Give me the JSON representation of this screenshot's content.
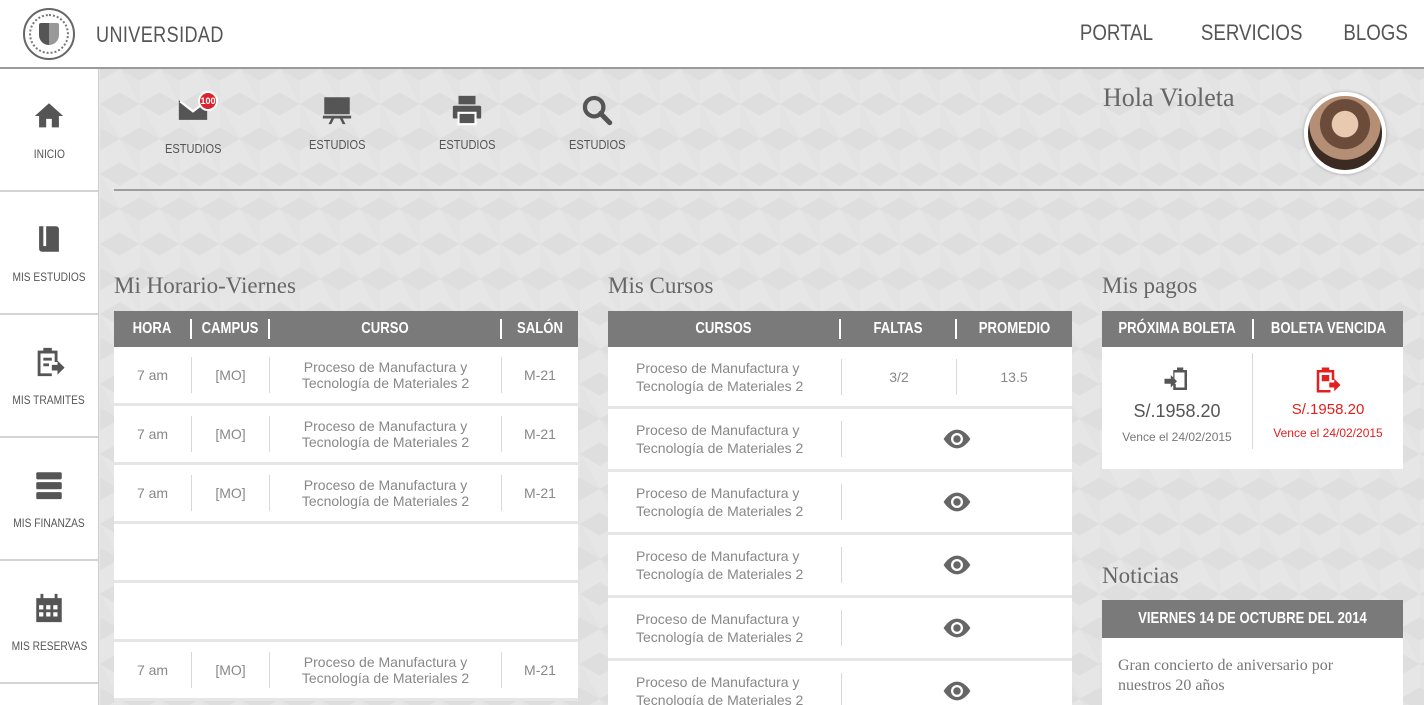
{
  "header": {
    "brand": "UNIVERSIDAD",
    "nav": [
      "PORTAL",
      "SERVICIOS",
      "BLOGS"
    ]
  },
  "sidebar": {
    "items": [
      {
        "label": "INICIO",
        "icon": "home-icon"
      },
      {
        "label": "MIS ESTUDIOS",
        "icon": "book-icon"
      },
      {
        "label": "MIS TRAMITES",
        "icon": "clipboard-arrow-icon"
      },
      {
        "label": "MIS FINANZAS",
        "icon": "server-icon"
      },
      {
        "label": "MIS RESERVAS",
        "icon": "calendar-icon"
      }
    ]
  },
  "quick_actions": [
    {
      "label": "ESTUDIOS",
      "icon": "mail-icon",
      "badge": "100"
    },
    {
      "label": "ESTUDIOS",
      "icon": "desktop-icon"
    },
    {
      "label": "ESTUDIOS",
      "icon": "printer-icon"
    },
    {
      "label": "ESTUDIOS",
      "icon": "search-icon"
    }
  ],
  "greeting": "Hola Violeta",
  "horario": {
    "title": "Mi Horario-Viernes",
    "columns": [
      "HORA",
      "CAMPUS",
      "CURSO",
      "SALÓN"
    ],
    "rows": [
      {
        "hora": "7 am",
        "campus": "[MO]",
        "curso_l1": "Proceso de Manufactura y",
        "curso_l2": "Tecnología de Materiales 2",
        "salon": "M-21"
      },
      {
        "hora": "7 am",
        "campus": "[MO]",
        "curso_l1": "Proceso de Manufactura y",
        "curso_l2": "Tecnología de Materiales 2",
        "salon": "M-21"
      },
      {
        "hora": "7 am",
        "campus": "[MO]",
        "curso_l1": "Proceso de Manufactura y",
        "curso_l2": "Tecnología de Materiales 2",
        "salon": "M-21"
      },
      {
        "hora": "",
        "campus": "",
        "curso_l1": "",
        "curso_l2": "",
        "salon": ""
      },
      {
        "hora": "",
        "campus": "",
        "curso_l1": "",
        "curso_l2": "",
        "salon": ""
      },
      {
        "hora": "7 am",
        "campus": "[MO]",
        "curso_l1": "Proceso de Manufactura y",
        "curso_l2": "Tecnología de Materiales 2",
        "salon": "M-21"
      }
    ]
  },
  "cursos": {
    "title": "Mis Cursos",
    "columns": [
      "CURSOS",
      "FALTAS",
      "PROMEDIO"
    ],
    "rows": [
      {
        "curso_l1": "Proceso de Manufactura y",
        "curso_l2": "Tecnología de Materiales 2",
        "faltas": "3/2",
        "promedio": "13.5"
      },
      {
        "curso_l1": "Proceso de Manufactura y",
        "curso_l2": "Tecnología de Materiales 2"
      },
      {
        "curso_l1": "Proceso de Manufactura y",
        "curso_l2": "Tecnología de Materiales 2"
      },
      {
        "curso_l1": "Proceso de Manufactura y",
        "curso_l2": "Tecnología de Materiales 2"
      },
      {
        "curso_l1": "Proceso de Manufactura y",
        "curso_l2": "Tecnología de Materiales 2"
      },
      {
        "curso_l1": "Proceso de Manufactura y",
        "curso_l2": "Tecnología de Materiales 2"
      }
    ]
  },
  "pagos": {
    "title": "Mis pagos",
    "columns": [
      "PRÓXIMA BOLETA",
      "BOLETA VENCIDA"
    ],
    "proxima": {
      "amount": "S/.1958.20",
      "due": "Vence el 24/02/2015"
    },
    "vencida": {
      "amount": "S/.1958.20",
      "due": "Vence el 24/02/2015"
    },
    "colors": {
      "normal": "#555555",
      "overdue": "#e32020"
    }
  },
  "noticias": {
    "title": "Noticias",
    "date": "VIERNES 14 DE OCTUBRE DEL 2014",
    "text": "Gran concierto de aniversario por nuestros 20 años"
  }
}
